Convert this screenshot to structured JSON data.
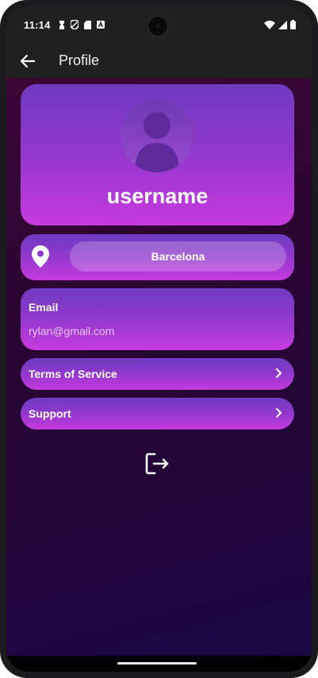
{
  "status": {
    "time": "11:14",
    "left_icons": [
      "notification-icon",
      "shield-icon",
      "sd-card-icon",
      "text-a-icon"
    ],
    "right_icons": [
      "wifi-icon",
      "signal-icon",
      "battery-icon"
    ]
  },
  "appbar": {
    "title": "Profile"
  },
  "profile": {
    "username": "username"
  },
  "location": {
    "city": "Barcelona"
  },
  "email": {
    "label": "Email",
    "value": "rylan@gmail.com"
  },
  "menu": [
    {
      "label": "Terms of Service"
    },
    {
      "label": "Support"
    }
  ],
  "colors": {
    "card_top": "#6f3bc0",
    "card_bottom": "#c63bdd",
    "background": "#2a0530",
    "bar": "#202020"
  }
}
